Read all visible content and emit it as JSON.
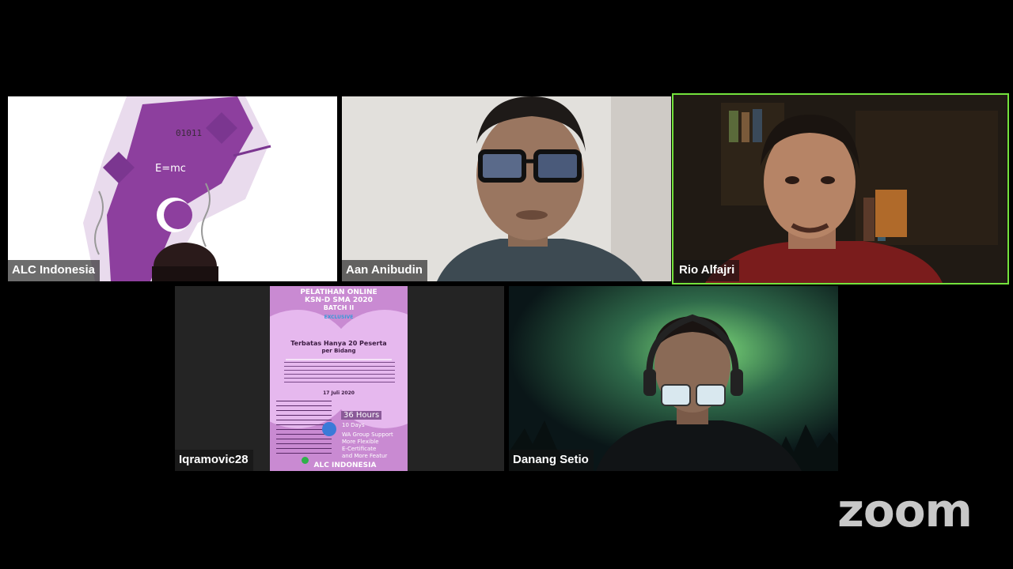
{
  "participants": [
    {
      "name": "ALC Indonesia",
      "active": false
    },
    {
      "name": "Aan Anibudin",
      "active": false
    },
    {
      "name": "Rio Alfajri",
      "active": true
    },
    {
      "name": "Iqramovic28",
      "active": false
    },
    {
      "name": "Danang Setio",
      "active": false
    }
  ],
  "logo_tile": {
    "formula": "E=mc",
    "binary": "01011"
  },
  "poster": {
    "title1": "PELATIHAN ONLINE",
    "title2": "KSN-D SMA 2020",
    "title3": "BATCH II",
    "exclusive": "EXCLUSIVE",
    "limit1": "Terbatas Hanya 20 Peserta",
    "limit2": "per Bidang",
    "date": "17 Juli 2020",
    "hours": "36 Hours",
    "days": "10 Days",
    "wa": "WA Group Support",
    "flex": "More Flexible",
    "cert": "E-Certificate",
    "more": "and More Featur",
    "footer": "ALC INDONESIA"
  },
  "brand": {
    "zoom_logo": "zoom",
    "active_color": "#73e23c"
  }
}
